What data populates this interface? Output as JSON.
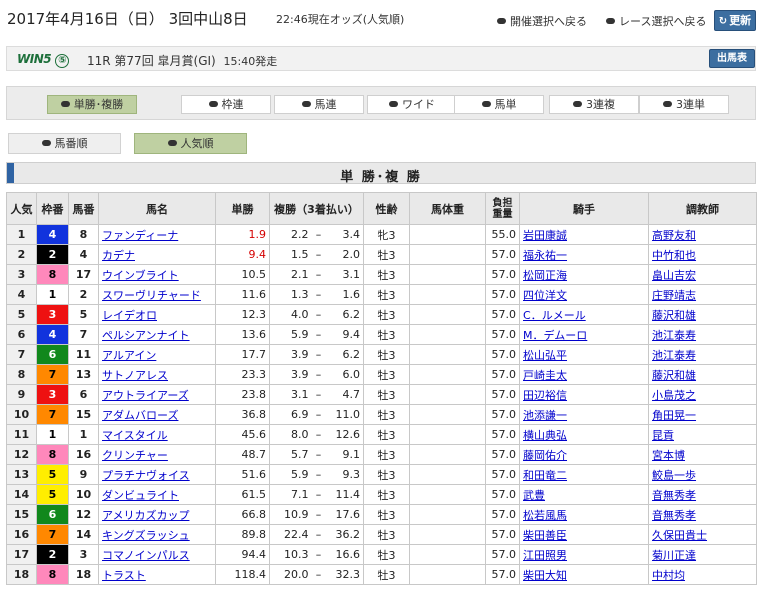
{
  "header": {
    "date": "2017年4月16日（日） 3回中山8日",
    "odds_note": "22:46現在オッズ(人気順)",
    "back_meet": "開催選択へ戻る",
    "back_race": "レース選択へ戻る",
    "refresh": "更新"
  },
  "race": {
    "win5_logo": "WIN5",
    "win5_number": "⑤",
    "info": "11R 第77回 皐月賞(GI)",
    "start": "15:40発走",
    "card_button": "出馬表"
  },
  "tabs": [
    "単勝･複勝",
    "枠連",
    "馬連",
    "ワイド",
    "馬単",
    "3連複",
    "3連単"
  ],
  "active_tab": 0,
  "sort_buttons": [
    "馬番順",
    "人気順"
  ],
  "active_sort": 1,
  "section_title": "単 勝･複 勝",
  "columns": {
    "ninki": "人気",
    "waku": "枠番",
    "umaban": "馬番",
    "name": "馬名",
    "win": "単勝",
    "place": "複勝（3着払い）",
    "sexage": "性齢",
    "weight": "馬体重",
    "burden1": "負担",
    "burden2": "重量",
    "jockey": "騎手",
    "trainer": "調教師"
  },
  "waku_colors": {
    "1": {
      "bg": "#ffffff",
      "fg": "#000000"
    },
    "2": {
      "bg": "#000000",
      "fg": "#ffffff"
    },
    "3": {
      "bg": "#ee1111",
      "fg": "#ffffff"
    },
    "4": {
      "bg": "#1133dd",
      "fg": "#ffffff"
    },
    "5": {
      "bg": "#ffee00",
      "fg": "#000000"
    },
    "6": {
      "bg": "#11881c",
      "fg": "#ffffff"
    },
    "7": {
      "bg": "#ff8800",
      "fg": "#000000"
    },
    "8": {
      "bg": "#ff88bb",
      "fg": "#000000"
    }
  },
  "rows": [
    {
      "ninki": "1",
      "waku": "4",
      "umaban": "8",
      "name": "ファンディーナ",
      "win": "1.9",
      "pmin": "2.2",
      "pmax": "3.4",
      "sex": "牝3",
      "weight": "",
      "burden": "55.0",
      "jockey": "岩田康誠",
      "trainer": "高野友和",
      "hl": true
    },
    {
      "ninki": "2",
      "waku": "2",
      "umaban": "4",
      "name": "カデナ",
      "win": "9.4",
      "pmin": "1.5",
      "pmax": "2.0",
      "sex": "牡3",
      "weight": "",
      "burden": "57.0",
      "jockey": "福永祐一",
      "trainer": "中竹和也",
      "hl": true
    },
    {
      "ninki": "3",
      "waku": "8",
      "umaban": "17",
      "name": "ウインブライト",
      "win": "10.5",
      "pmin": "2.1",
      "pmax": "3.1",
      "sex": "牡3",
      "weight": "",
      "burden": "57.0",
      "jockey": "松岡正海",
      "trainer": "畠山吉宏",
      "hl": false
    },
    {
      "ninki": "4",
      "waku": "1",
      "umaban": "2",
      "name": "スワーヴリチャード",
      "win": "11.6",
      "pmin": "1.3",
      "pmax": "1.6",
      "sex": "牡3",
      "weight": "",
      "burden": "57.0",
      "jockey": "四位洋文",
      "trainer": "庄野靖志",
      "hl": false
    },
    {
      "ninki": "5",
      "waku": "3",
      "umaban": "5",
      "name": "レイデオロ",
      "win": "12.3",
      "pmin": "4.0",
      "pmax": "6.2",
      "sex": "牡3",
      "weight": "",
      "burden": "57.0",
      "jockey": "C．ルメール",
      "trainer": "藤沢和雄",
      "hl": false
    },
    {
      "ninki": "6",
      "waku": "4",
      "umaban": "7",
      "name": "ペルシアンナイト",
      "win": "13.6",
      "pmin": "5.9",
      "pmax": "9.4",
      "sex": "牡3",
      "weight": "",
      "burden": "57.0",
      "jockey": "M．デムーロ",
      "trainer": "池江泰寿",
      "hl": false
    },
    {
      "ninki": "7",
      "waku": "6",
      "umaban": "11",
      "name": "アルアイン",
      "win": "17.7",
      "pmin": "3.9",
      "pmax": "6.2",
      "sex": "牡3",
      "weight": "",
      "burden": "57.0",
      "jockey": "松山弘平",
      "trainer": "池江泰寿",
      "hl": false
    },
    {
      "ninki": "8",
      "waku": "7",
      "umaban": "13",
      "name": "サトノアレス",
      "win": "23.3",
      "pmin": "3.9",
      "pmax": "6.0",
      "sex": "牡3",
      "weight": "",
      "burden": "57.0",
      "jockey": "戸崎圭太",
      "trainer": "藤沢和雄",
      "hl": false
    },
    {
      "ninki": "9",
      "waku": "3",
      "umaban": "6",
      "name": "アウトライアーズ",
      "win": "23.8",
      "pmin": "3.1",
      "pmax": "4.7",
      "sex": "牡3",
      "weight": "",
      "burden": "57.0",
      "jockey": "田辺裕信",
      "trainer": "小島茂之",
      "hl": false
    },
    {
      "ninki": "10",
      "waku": "7",
      "umaban": "15",
      "name": "アダムバローズ",
      "win": "36.8",
      "pmin": "6.9",
      "pmax": "11.0",
      "sex": "牡3",
      "weight": "",
      "burden": "57.0",
      "jockey": "池添謙一",
      "trainer": "角田晃一",
      "hl": false
    },
    {
      "ninki": "11",
      "waku": "1",
      "umaban": "1",
      "name": "マイスタイル",
      "win": "45.6",
      "pmin": "8.0",
      "pmax": "12.6",
      "sex": "牡3",
      "weight": "",
      "burden": "57.0",
      "jockey": "横山典弘",
      "trainer": "昆貢",
      "hl": false
    },
    {
      "ninki": "12",
      "waku": "8",
      "umaban": "16",
      "name": "クリンチャー",
      "win": "48.7",
      "pmin": "5.7",
      "pmax": "9.1",
      "sex": "牡3",
      "weight": "",
      "burden": "57.0",
      "jockey": "藤岡佑介",
      "trainer": "宮本博",
      "hl": false
    },
    {
      "ninki": "13",
      "waku": "5",
      "umaban": "9",
      "name": "プラチナヴォイス",
      "win": "51.6",
      "pmin": "5.9",
      "pmax": "9.3",
      "sex": "牡3",
      "weight": "",
      "burden": "57.0",
      "jockey": "和田竜二",
      "trainer": "鮫島一歩",
      "hl": false
    },
    {
      "ninki": "14",
      "waku": "5",
      "umaban": "10",
      "name": "ダンビュライト",
      "win": "61.5",
      "pmin": "7.1",
      "pmax": "11.4",
      "sex": "牡3",
      "weight": "",
      "burden": "57.0",
      "jockey": "武豊",
      "trainer": "音無秀孝",
      "hl": false
    },
    {
      "ninki": "15",
      "waku": "6",
      "umaban": "12",
      "name": "アメリカズカップ",
      "win": "66.8",
      "pmin": "10.9",
      "pmax": "17.6",
      "sex": "牡3",
      "weight": "",
      "burden": "57.0",
      "jockey": "松若風馬",
      "trainer": "音無秀孝",
      "hl": false
    },
    {
      "ninki": "16",
      "waku": "7",
      "umaban": "14",
      "name": "キングズラッシュ",
      "win": "89.8",
      "pmin": "22.4",
      "pmax": "36.2",
      "sex": "牡3",
      "weight": "",
      "burden": "57.0",
      "jockey": "柴田善臣",
      "trainer": "久保田貴士",
      "hl": false
    },
    {
      "ninki": "17",
      "waku": "2",
      "umaban": "3",
      "name": "コマノインパルス",
      "win": "94.4",
      "pmin": "10.3",
      "pmax": "16.6",
      "sex": "牡3",
      "weight": "",
      "burden": "57.0",
      "jockey": "江田照男",
      "trainer": "菊川正達",
      "hl": false
    },
    {
      "ninki": "18",
      "waku": "8",
      "umaban": "18",
      "name": "トラスト",
      "win": "118.4",
      "pmin": "20.0",
      "pmax": "32.3",
      "sex": "牡3",
      "weight": "",
      "burden": "57.0",
      "jockey": "柴田大知",
      "trainer": "中村均",
      "hl": false
    }
  ]
}
